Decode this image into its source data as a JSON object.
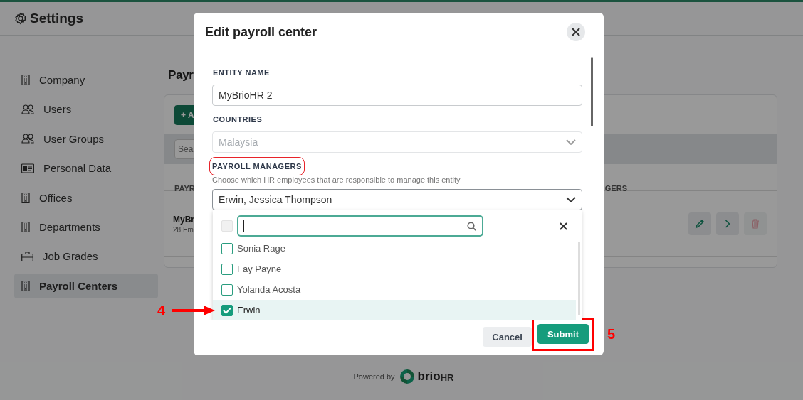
{
  "header": {
    "title": "Settings"
  },
  "sidebar": {
    "items": [
      {
        "label": "Company",
        "kind": "building",
        "selected": false
      },
      {
        "label": "Users",
        "kind": "users",
        "selected": false
      },
      {
        "label": "User Groups",
        "kind": "users",
        "selected": false
      },
      {
        "label": "Personal Data",
        "kind": "card",
        "selected": false
      },
      {
        "label": "Offices",
        "kind": "building",
        "selected": false
      },
      {
        "label": "Departments",
        "kind": "building",
        "selected": false
      },
      {
        "label": "Job Grades",
        "kind": "briefcase",
        "selected": false
      },
      {
        "label": "Payroll Centers",
        "kind": "building",
        "selected": true
      }
    ]
  },
  "page": {
    "title": "Payr",
    "add_button": "+ A",
    "search": {
      "placeholder": "Sea"
    },
    "table": {
      "columns": [
        "PAYR",
        "GERS"
      ],
      "rows": [
        {
          "name": "MyBr",
          "subtitle": "28 Em",
          "actions": [
            {
              "kind": "edit",
              "disabled": false
            },
            {
              "kind": "open",
              "disabled": false
            },
            {
              "kind": "delete",
              "disabled": true
            }
          ]
        }
      ]
    }
  },
  "footer": {
    "powered_by": "Powered by",
    "logo_bold": "brio",
    "logo_light": "HR"
  },
  "dialog": {
    "title": "Edit payroll center",
    "fields": [
      {
        "kind": "input",
        "label": "ENTITY NAME",
        "value": "MyBrioHR 2",
        "disabled": false,
        "highlighted": false
      },
      {
        "kind": "select",
        "label": "COUNTRIES",
        "value": "Malaysia",
        "disabled": true,
        "highlighted": false
      },
      {
        "kind": "multiselect",
        "label": "PAYROLL MANAGERS",
        "help": "Choose which HR employees that are responsible to manage this entity",
        "value": "Erwin, Jessica Thompson",
        "disabled": false,
        "highlighted": true,
        "expanded": true,
        "dropdown": {
          "select_all": {
            "checked": false,
            "disabled": true
          },
          "options": [
            {
              "label": "Sonia Rage",
              "checked": false,
              "highlighted": false
            },
            {
              "label": "Fay Payne",
              "checked": false,
              "highlighted": false
            },
            {
              "label": "Yolanda Acosta",
              "checked": false,
              "highlighted": false
            },
            {
              "label": "Erwin",
              "checked": true,
              "highlighted": true
            }
          ]
        }
      }
    ],
    "buttons": [
      {
        "kind": "secondary",
        "label": "Cancel",
        "highlighted": false
      },
      {
        "kind": "primary",
        "label": "Submit",
        "highlighted": true
      }
    ]
  },
  "annotations": [
    {
      "kind": "arrow",
      "number": "4"
    },
    {
      "kind": "step",
      "number": "5"
    }
  ]
}
